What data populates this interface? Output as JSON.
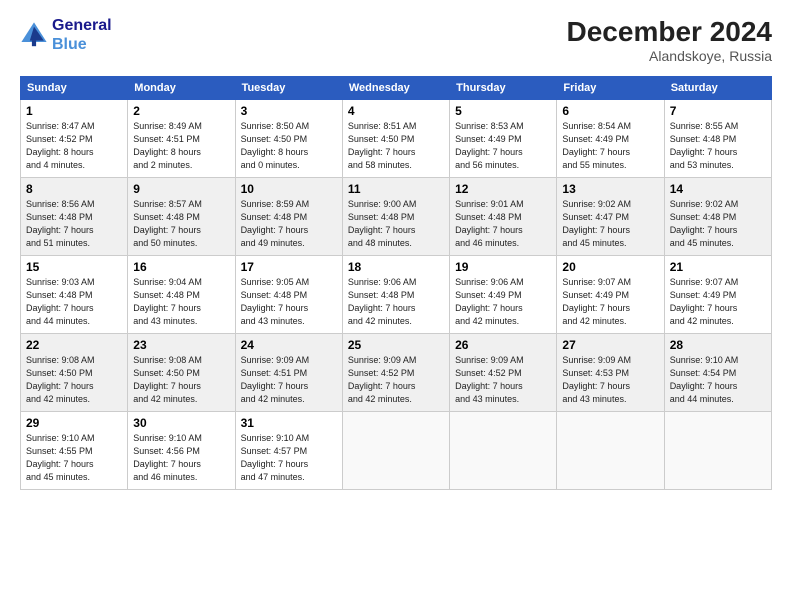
{
  "header": {
    "logo_line1": "General",
    "logo_line2": "Blue",
    "month_title": "December 2024",
    "location": "Alandskoye, Russia"
  },
  "weekdays": [
    "Sunday",
    "Monday",
    "Tuesday",
    "Wednesday",
    "Thursday",
    "Friday",
    "Saturday"
  ],
  "weeks": [
    [
      {
        "day": "1",
        "info": "Sunrise: 8:47 AM\nSunset: 4:52 PM\nDaylight: 8 hours\nand 4 minutes."
      },
      {
        "day": "2",
        "info": "Sunrise: 8:49 AM\nSunset: 4:51 PM\nDaylight: 8 hours\nand 2 minutes."
      },
      {
        "day": "3",
        "info": "Sunrise: 8:50 AM\nSunset: 4:50 PM\nDaylight: 8 hours\nand 0 minutes."
      },
      {
        "day": "4",
        "info": "Sunrise: 8:51 AM\nSunset: 4:50 PM\nDaylight: 7 hours\nand 58 minutes."
      },
      {
        "day": "5",
        "info": "Sunrise: 8:53 AM\nSunset: 4:49 PM\nDaylight: 7 hours\nand 56 minutes."
      },
      {
        "day": "6",
        "info": "Sunrise: 8:54 AM\nSunset: 4:49 PM\nDaylight: 7 hours\nand 55 minutes."
      },
      {
        "day": "7",
        "info": "Sunrise: 8:55 AM\nSunset: 4:48 PM\nDaylight: 7 hours\nand 53 minutes."
      }
    ],
    [
      {
        "day": "8",
        "info": "Sunrise: 8:56 AM\nSunset: 4:48 PM\nDaylight: 7 hours\nand 51 minutes."
      },
      {
        "day": "9",
        "info": "Sunrise: 8:57 AM\nSunset: 4:48 PM\nDaylight: 7 hours\nand 50 minutes."
      },
      {
        "day": "10",
        "info": "Sunrise: 8:59 AM\nSunset: 4:48 PM\nDaylight: 7 hours\nand 49 minutes."
      },
      {
        "day": "11",
        "info": "Sunrise: 9:00 AM\nSunset: 4:48 PM\nDaylight: 7 hours\nand 48 minutes."
      },
      {
        "day": "12",
        "info": "Sunrise: 9:01 AM\nSunset: 4:48 PM\nDaylight: 7 hours\nand 46 minutes."
      },
      {
        "day": "13",
        "info": "Sunrise: 9:02 AM\nSunset: 4:47 PM\nDaylight: 7 hours\nand 45 minutes."
      },
      {
        "day": "14",
        "info": "Sunrise: 9:02 AM\nSunset: 4:48 PM\nDaylight: 7 hours\nand 45 minutes."
      }
    ],
    [
      {
        "day": "15",
        "info": "Sunrise: 9:03 AM\nSunset: 4:48 PM\nDaylight: 7 hours\nand 44 minutes."
      },
      {
        "day": "16",
        "info": "Sunrise: 9:04 AM\nSunset: 4:48 PM\nDaylight: 7 hours\nand 43 minutes."
      },
      {
        "day": "17",
        "info": "Sunrise: 9:05 AM\nSunset: 4:48 PM\nDaylight: 7 hours\nand 43 minutes."
      },
      {
        "day": "18",
        "info": "Sunrise: 9:06 AM\nSunset: 4:48 PM\nDaylight: 7 hours\nand 42 minutes."
      },
      {
        "day": "19",
        "info": "Sunrise: 9:06 AM\nSunset: 4:49 PM\nDaylight: 7 hours\nand 42 minutes."
      },
      {
        "day": "20",
        "info": "Sunrise: 9:07 AM\nSunset: 4:49 PM\nDaylight: 7 hours\nand 42 minutes."
      },
      {
        "day": "21",
        "info": "Sunrise: 9:07 AM\nSunset: 4:49 PM\nDaylight: 7 hours\nand 42 minutes."
      }
    ],
    [
      {
        "day": "22",
        "info": "Sunrise: 9:08 AM\nSunset: 4:50 PM\nDaylight: 7 hours\nand 42 minutes."
      },
      {
        "day": "23",
        "info": "Sunrise: 9:08 AM\nSunset: 4:50 PM\nDaylight: 7 hours\nand 42 minutes."
      },
      {
        "day": "24",
        "info": "Sunrise: 9:09 AM\nSunset: 4:51 PM\nDaylight: 7 hours\nand 42 minutes."
      },
      {
        "day": "25",
        "info": "Sunrise: 9:09 AM\nSunset: 4:52 PM\nDaylight: 7 hours\nand 42 minutes."
      },
      {
        "day": "26",
        "info": "Sunrise: 9:09 AM\nSunset: 4:52 PM\nDaylight: 7 hours\nand 43 minutes."
      },
      {
        "day": "27",
        "info": "Sunrise: 9:09 AM\nSunset: 4:53 PM\nDaylight: 7 hours\nand 43 minutes."
      },
      {
        "day": "28",
        "info": "Sunrise: 9:10 AM\nSunset: 4:54 PM\nDaylight: 7 hours\nand 44 minutes."
      }
    ],
    [
      {
        "day": "29",
        "info": "Sunrise: 9:10 AM\nSunset: 4:55 PM\nDaylight: 7 hours\nand 45 minutes."
      },
      {
        "day": "30",
        "info": "Sunrise: 9:10 AM\nSunset: 4:56 PM\nDaylight: 7 hours\nand 46 minutes."
      },
      {
        "day": "31",
        "info": "Sunrise: 9:10 AM\nSunset: 4:57 PM\nDaylight: 7 hours\nand 47 minutes."
      },
      {
        "day": "",
        "info": ""
      },
      {
        "day": "",
        "info": ""
      },
      {
        "day": "",
        "info": ""
      },
      {
        "day": "",
        "info": ""
      }
    ]
  ]
}
